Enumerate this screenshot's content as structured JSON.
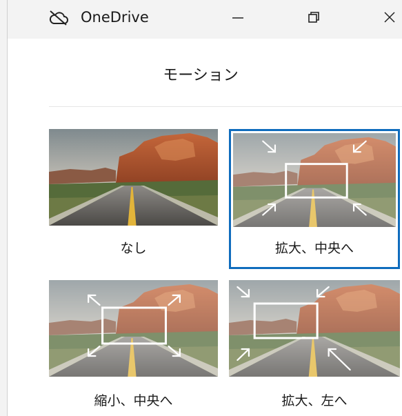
{
  "window": {
    "title": "OneDrive",
    "icon": "cloud-off-icon",
    "controls": [
      "minimize-icon",
      "maximize-icon",
      "close-icon"
    ]
  },
  "panel": {
    "title": "モーション"
  },
  "options": [
    {
      "label": "なし",
      "selected": false,
      "overlay": "none"
    },
    {
      "label": "拡大、中央へ",
      "selected": true,
      "overlay": "zoom-in-center"
    },
    {
      "label": "縮小、中央へ",
      "selected": false,
      "overlay": "zoom-out-center"
    },
    {
      "label": "拡大、左へ",
      "selected": false,
      "overlay": "zoom-in-left"
    }
  ],
  "colors": {
    "accent": "#0f6cbd",
    "titlebar": "#f3f3f3"
  }
}
